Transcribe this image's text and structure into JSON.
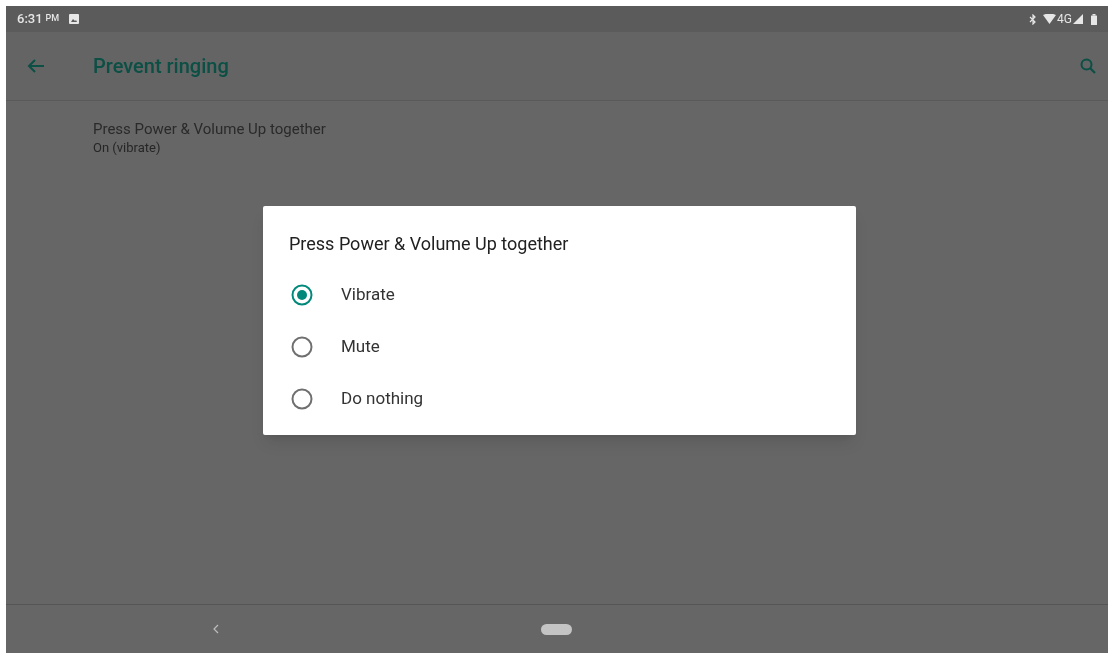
{
  "status_bar": {
    "time": "6:31",
    "am_pm": "PM",
    "network": "4G"
  },
  "toolbar": {
    "title": "Prevent ringing"
  },
  "settings": [
    {
      "title": "Press Power & Volume Up together",
      "summary": "On (vibrate)"
    }
  ],
  "dialog": {
    "title": "Press Power & Volume Up together",
    "options": [
      {
        "label": "Vibrate",
        "selected": true
      },
      {
        "label": "Mute",
        "selected": false
      },
      {
        "label": "Do nothing",
        "selected": false
      }
    ]
  }
}
